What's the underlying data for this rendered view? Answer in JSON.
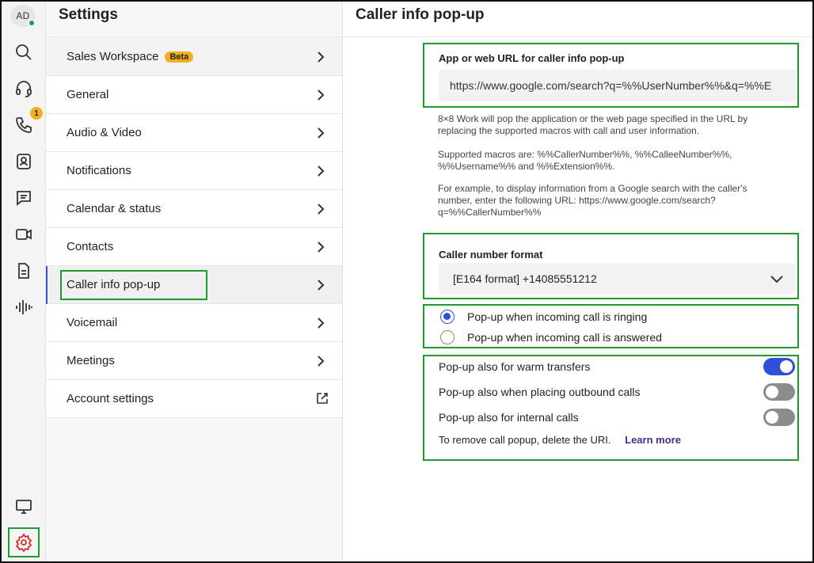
{
  "rail": {
    "avatar_initials": "AD",
    "phone_badge": "1",
    "icons": [
      "search-icon",
      "headset-icon",
      "phone-icon",
      "contacts-icon",
      "chat-icon",
      "video-icon",
      "document-icon",
      "voicemail-waveform-icon",
      "desktop-icon",
      "gear-icon"
    ]
  },
  "settings": {
    "title": "Settings",
    "items": [
      {
        "label": "Sales Workspace",
        "badge": "Beta"
      },
      {
        "label": "General"
      },
      {
        "label": "Audio & Video"
      },
      {
        "label": "Notifications"
      },
      {
        "label": "Calendar & status"
      },
      {
        "label": "Contacts"
      },
      {
        "label": "Caller info pop-up",
        "active": true
      },
      {
        "label": "Voicemail"
      },
      {
        "label": "Meetings"
      },
      {
        "label": "Account settings",
        "external": true
      }
    ]
  },
  "main": {
    "title": "Caller info pop-up",
    "url_label": "App or web URL for caller info pop-up",
    "url_value": "https://www.google.com/search?q=%%UserNumber%%&q=%%E",
    "help1": "8×8 Work will pop the application or the web page specified in the URL by replacing the supported macros with call and user information.",
    "help2": "Supported macros are: %%CallerNumber%%, %%CalleeNumber%%, %%Username%% and %%Extension%%.",
    "help3": "For example, to display information from a Google search with the caller's number, enter the following URL: https://www.google.com/search?q=%%CallerNumber%%",
    "format_label": "Caller number format",
    "format_value": "[E164 format] +14085551212",
    "radio_ringing": "Pop-up when incoming call is ringing",
    "radio_answered": "Pop-up when incoming call is answered",
    "toggle_warm": {
      "label": "Pop-up also for warm transfers",
      "on": true
    },
    "toggle_outbound": {
      "label": "Pop-up also when placing outbound calls",
      "on": false
    },
    "toggle_internal": {
      "label": "Pop-up also for internal calls",
      "on": false
    },
    "remove_text": "To remove call popup, delete the URI.",
    "learn_more": "Learn more"
  },
  "colors": {
    "accent": "#2f4fd6",
    "highlight": "#1f9a2e",
    "badge": "#f2b01e"
  }
}
